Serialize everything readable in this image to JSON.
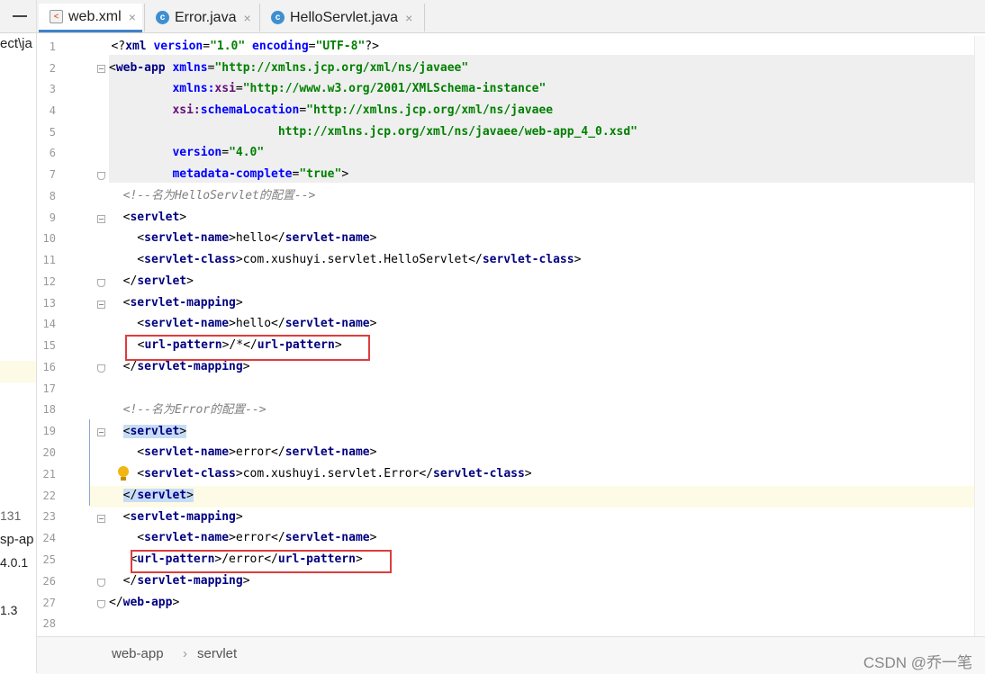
{
  "left_panel": {
    "frag1": "ect\\ja",
    "frag2": "131",
    "frag3": "sp-ap",
    "frag4": "4.0.1",
    "frag5": "1.3"
  },
  "tabs": [
    {
      "label": "web.xml",
      "icon": "xml-file-icon",
      "active": true
    },
    {
      "label": "Error.java",
      "icon": "java-class-icon",
      "active": false
    },
    {
      "label": "HelloServlet.java",
      "icon": "java-class-icon",
      "active": false
    }
  ],
  "close_glyph": "×",
  "line_numbers": [
    "1",
    "2",
    "3",
    "4",
    "5",
    "6",
    "7",
    "8",
    "9",
    "10",
    "11",
    "12",
    "13",
    "14",
    "15",
    "16",
    "17",
    "18",
    "19",
    "20",
    "21",
    "22",
    "23",
    "24",
    "25",
    "26",
    "27",
    "28"
  ],
  "code": {
    "l1": {
      "a": "<?",
      "b": "xml",
      "c": " version",
      "d": "=",
      "e": "\"1.0\"",
      "f": " encoding",
      "g": "=",
      "h": "\"UTF-8\"",
      "i": "?>"
    },
    "l2": {
      "a": "<",
      "b": "web-app",
      "c": " xmlns",
      "d": "=",
      "e": "\"http://xmlns.jcp.org/xml/ns/javaee\""
    },
    "l3": {
      "a": "         ",
      "b": "xmlns:",
      "c": "xsi",
      "d": "=",
      "e": "\"http://www.w3.org/2001/XMLSchema-instance\""
    },
    "l4": {
      "a": "         ",
      "b": "xsi:",
      "c": "schemaLocation",
      "d": "=",
      "e": "\"http://xmlns.jcp.org/xml/ns/javaee"
    },
    "l5": {
      "a": "                        ",
      "b": "http://xmlns.jcp.org/xml/ns/javaee/web-app_4_0.xsd\""
    },
    "l6": {
      "a": "         ",
      "b": "version",
      "c": "=",
      "d": "\"4.0\""
    },
    "l7": {
      "a": "         ",
      "b": "metadata-complete",
      "c": "=",
      "d": "\"true\"",
      "e": ">"
    },
    "l8": {
      "a": "  ",
      "b": "<!--名为HelloServlet的配置-->"
    },
    "l9": {
      "a": "  <",
      "b": "servlet",
      "c": ">"
    },
    "l10": {
      "a": "    <",
      "b": "servlet-name",
      "c": ">",
      "d": "hello",
      "e": "</",
      "f": "servlet-name",
      "g": ">"
    },
    "l11": {
      "a": "    <",
      "b": "servlet-class",
      "c": ">",
      "d": "com.xushuyi.servlet.HelloServlet",
      "e": "</",
      "f": "servlet-class",
      "g": ">"
    },
    "l12": {
      "a": "  </",
      "b": "servlet",
      "c": ">"
    },
    "l13": {
      "a": "  <",
      "b": "servlet-mapping",
      "c": ">"
    },
    "l14": {
      "a": "    <",
      "b": "servlet-name",
      "c": ">",
      "d": "hello",
      "e": "</",
      "f": "servlet-name",
      "g": ">"
    },
    "l15": {
      "a": "  <",
      "b": "url-pattern",
      "c": ">",
      "d": "/*",
      "e": "</",
      "f": "url-pattern",
      "g": ">"
    },
    "l16": {
      "a": "  </",
      "b": "servlet-mapping",
      "c": ">"
    },
    "l18": {
      "a": "  ",
      "b": "<!--名为Error的配置-->"
    },
    "l19": {
      "a": "  ",
      "b": "<",
      "c": "servlet",
      "d": ">"
    },
    "l20": {
      "a": "    <",
      "b": "servlet-name",
      "c": ">",
      "d": "error",
      "e": "</",
      "f": "servlet-name",
      "g": ">"
    },
    "l21": {
      "a": "    <",
      "b": "servlet-class",
      "c": ">",
      "d": "com.xushuyi.servlet.Error",
      "e": "</",
      "f": "servlet-class",
      "g": ">"
    },
    "l22": {
      "a": "  ",
      "b": "</",
      "c": "servlet",
      "d": ">"
    },
    "l23": {
      "a": "  <",
      "b": "servlet-mapping",
      "c": ">"
    },
    "l24": {
      "a": "    <",
      "b": "servlet-name",
      "c": ">",
      "d": "error",
      "e": "</",
      "f": "servlet-name",
      "g": ">"
    },
    "l25": {
      "a": "   <",
      "b": "url-pattern",
      "c": ">",
      "d": "/error",
      "e": "</",
      "f": "url-pattern",
      "g": ">"
    },
    "l26": {
      "a": "  </",
      "b": "servlet-mapping",
      "c": ">"
    },
    "l27": {
      "a": "</",
      "b": "web-app",
      "c": ">"
    }
  },
  "breadcrumb": [
    "web-app",
    "servlet"
  ],
  "breadcrumb_sep": "›",
  "watermark": "CSDN @乔一笔",
  "colors": {
    "tag": "#000080",
    "attr": "#0000ff",
    "value": "#008000",
    "comment": "#808080",
    "highlight_box": "#e03c3c",
    "active_tab": "#4083c9"
  }
}
